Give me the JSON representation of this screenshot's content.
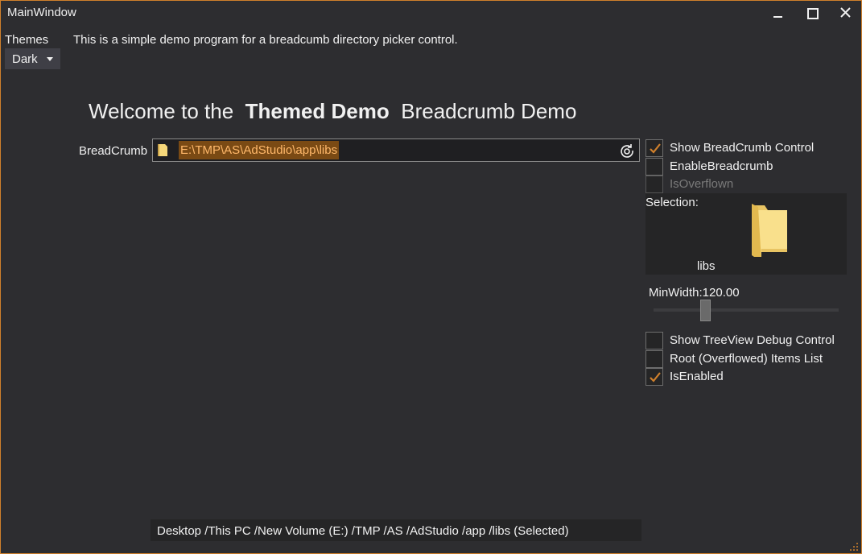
{
  "window": {
    "title": "MainWindow"
  },
  "themes": {
    "label": "Themes",
    "selected": "Dark"
  },
  "intro_text": "This is a simple demo program for a breadcumb directory picker control.",
  "welcome": {
    "prefix": "Welcome to the",
    "bold": "Themed Demo",
    "suffix": "Breadcrumb Demo"
  },
  "breadcrumb": {
    "label": "BreadCrumb",
    "path": "E:\\TMP\\AS\\AdStudio\\app\\libs"
  },
  "options": {
    "show_breadcrumb": {
      "label": "Show BreadCrumb Control",
      "checked": true
    },
    "enable_breadcrumb": {
      "label": "EnableBreadcrumb",
      "checked": false
    },
    "is_overflown": {
      "label": "IsOverflown",
      "checked": false,
      "enabled": false
    },
    "show_treeview": {
      "label": "Show TreeView Debug Control",
      "checked": false
    },
    "root_items": {
      "label": "Root (Overflowed) Items List",
      "checked": false
    },
    "is_enabled": {
      "label": "IsEnabled",
      "checked": true
    }
  },
  "selection": {
    "label": "Selection:",
    "name": "libs"
  },
  "min_width": {
    "label": "MinWidth:120.00",
    "value": 120.0
  },
  "status_bar": {
    "text": "Desktop /This PC /New Volume (E:) /TMP /AS /AdStudio /app /libs (Selected)"
  },
  "colors": {
    "accent": "#d0802c",
    "background": "#2d2d30",
    "path_highlight": "#7a4a14",
    "path_text": "#ffb86a",
    "folder": "#f5d77a"
  }
}
